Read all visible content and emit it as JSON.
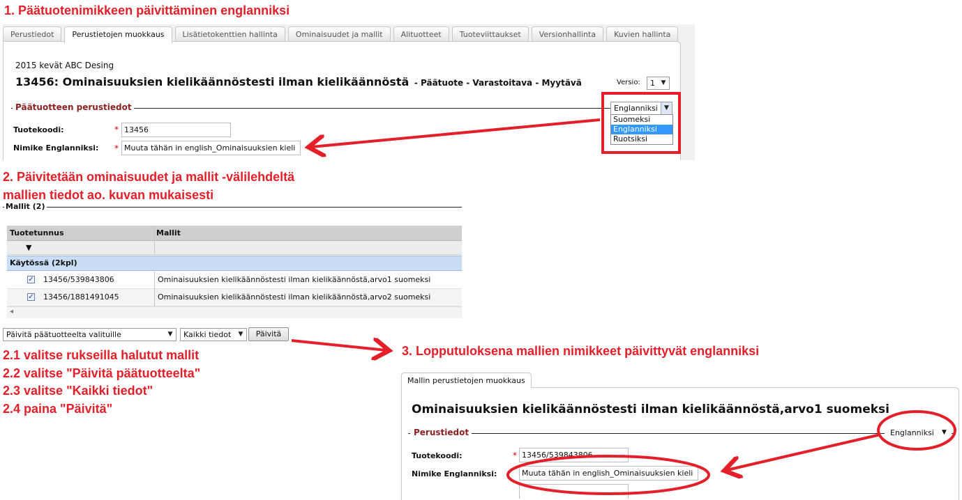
{
  "annotations": {
    "step1": "1. Päätuotenimikkeen päivittäminen englanniksi",
    "step2_line1": "2. Päivitetään ominaisuudet ja mallit -välilehdeltä",
    "step2_line2": "mallien tiedot ao. kuvan mukaisesti",
    "step2_1": "2.1 valitse rukseilla halutut mallit",
    "step2_2": "2.2 valitse \"Päivitä päätuotteelta\"",
    "step2_3": "2.3 valitse \"Kaikki tiedot\"",
    "step2_4": "2.4 paina \"Päivitä\"",
    "step3": "3. Lopputuloksena mallien nimikkeet päivittyvät englanniksi",
    "accent_color": "#e3202a"
  },
  "product_editor": {
    "tabs": [
      {
        "label": "Perustiedot",
        "active": false
      },
      {
        "label": "Perustietojen muokkaus",
        "active": true
      },
      {
        "label": "Lisätietokenttien hallinta",
        "active": false
      },
      {
        "label": "Ominaisuudet ja mallit",
        "active": false
      },
      {
        "label": "Alituotteet",
        "active": false
      },
      {
        "label": "Tuoteviittaukset",
        "active": false
      },
      {
        "label": "Versionhallinta",
        "active": false
      },
      {
        "label": "Kuvien hallinta",
        "active": false
      }
    ],
    "collection": "2015 kevät ABC Desing",
    "title": "13456: Ominaisuuksien kielikäännöstesti ilman kielikäännöstä",
    "subtitle": "- Päätuote - Varastoitava - Myytävä",
    "version_label": "Versio:",
    "version_value": "1",
    "section_title": "Päätuotteen perustiedot",
    "language_select": {
      "value": "Englanniksi",
      "options": [
        "Suomeksi",
        "Englanniksi",
        "Ruotsiksi"
      ],
      "selected_index": 1
    },
    "product_code_label": "Tuotekoodi:",
    "product_code_value": "13456",
    "name_label": "Nimike Englanniksi:",
    "name_value": "Muuta tähän in english_Ominaisuuksien kieli"
  },
  "models_section": {
    "title": "Mallit (2)",
    "columns": [
      "Tuotetunnus",
      "Mallit"
    ],
    "filter_icon": "triangle-down-icon",
    "group_label": "Käytössä (2kpl)",
    "rows": [
      {
        "checked": true,
        "code": "13456/539843806",
        "model": "Ominaisuuksien kielikäännöstesti ilman kielikäännöstä,arvo1 suomeksi"
      },
      {
        "checked": true,
        "code": "13456/1881491045",
        "model": "Ominaisuuksien kielikäännöstesti ilman kielikäännöstä,arvo2 suomeksi"
      }
    ],
    "scroll_arrow": "◂",
    "update_source_select": "Päivitä päätuotteelta valituille",
    "update_scope_select": "Kaikki tiedot",
    "update_button": "Päivitä"
  },
  "model_editor": {
    "tab_label": "Mallin perustietojen muokkaus",
    "title": "Ominaisuuksien kielikäännöstesti ilman kielikäännöstä,arvo1 suomeksi",
    "section_title": "Perustiedot",
    "language_value": "Englanniksi",
    "product_code_label": "Tuotekoodi:",
    "product_code_value": "13456/539843806",
    "name_label": "Nimike Englanniksi:",
    "name_value": "Muuta tähän in english_Ominaisuuksien kieli"
  }
}
